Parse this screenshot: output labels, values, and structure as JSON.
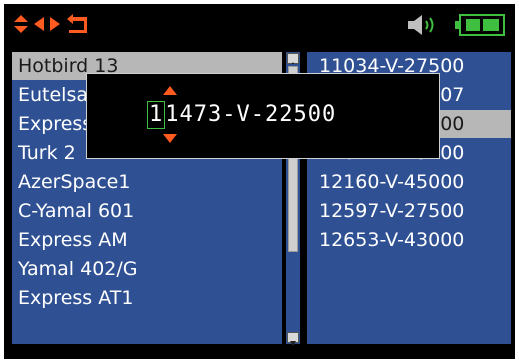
{
  "topbar": {
    "icons": [
      "up-down-arrows-icon",
      "left-arrow-icon",
      "right-arrow-icon",
      "back-icon",
      "speaker-icon",
      "battery-icon"
    ],
    "accent_color": "#ff5a1f",
    "battery_color": "#3fbf3f"
  },
  "satellite_list": {
    "items": [
      {
        "label": "Hotbird 13"
      },
      {
        "label": "Eutelsat"
      },
      {
        "label": "Express"
      },
      {
        "label": "Turk 2"
      },
      {
        "label": "AzerSpace1"
      },
      {
        "label": "C-Yamal 601"
      },
      {
        "label": "Express AM"
      },
      {
        "label": "Yamal 402/G"
      },
      {
        "label": "Express AT1"
      }
    ],
    "selected_index": 0
  },
  "transponder_list": {
    "items": [
      {
        "label": "11034-V-27500"
      },
      {
        "label": "11096-V-35007"
      },
      {
        "label": "11473-V-22500"
      },
      {
        "label": "11674-V-13200"
      },
      {
        "label": "12160-V-45000"
      },
      {
        "label": "12597-V-27500"
      },
      {
        "label": "12653-V-43000"
      }
    ],
    "selected_index": 2
  },
  "editor": {
    "cursor_digit": "1",
    "rest": "1473-V-22500"
  },
  "colors": {
    "list_bg": "#2f5194",
    "selected_bg": "#b7b7b7",
    "cursor_frame": "#3fbf3f",
    "caret": "#ff5a1f"
  }
}
